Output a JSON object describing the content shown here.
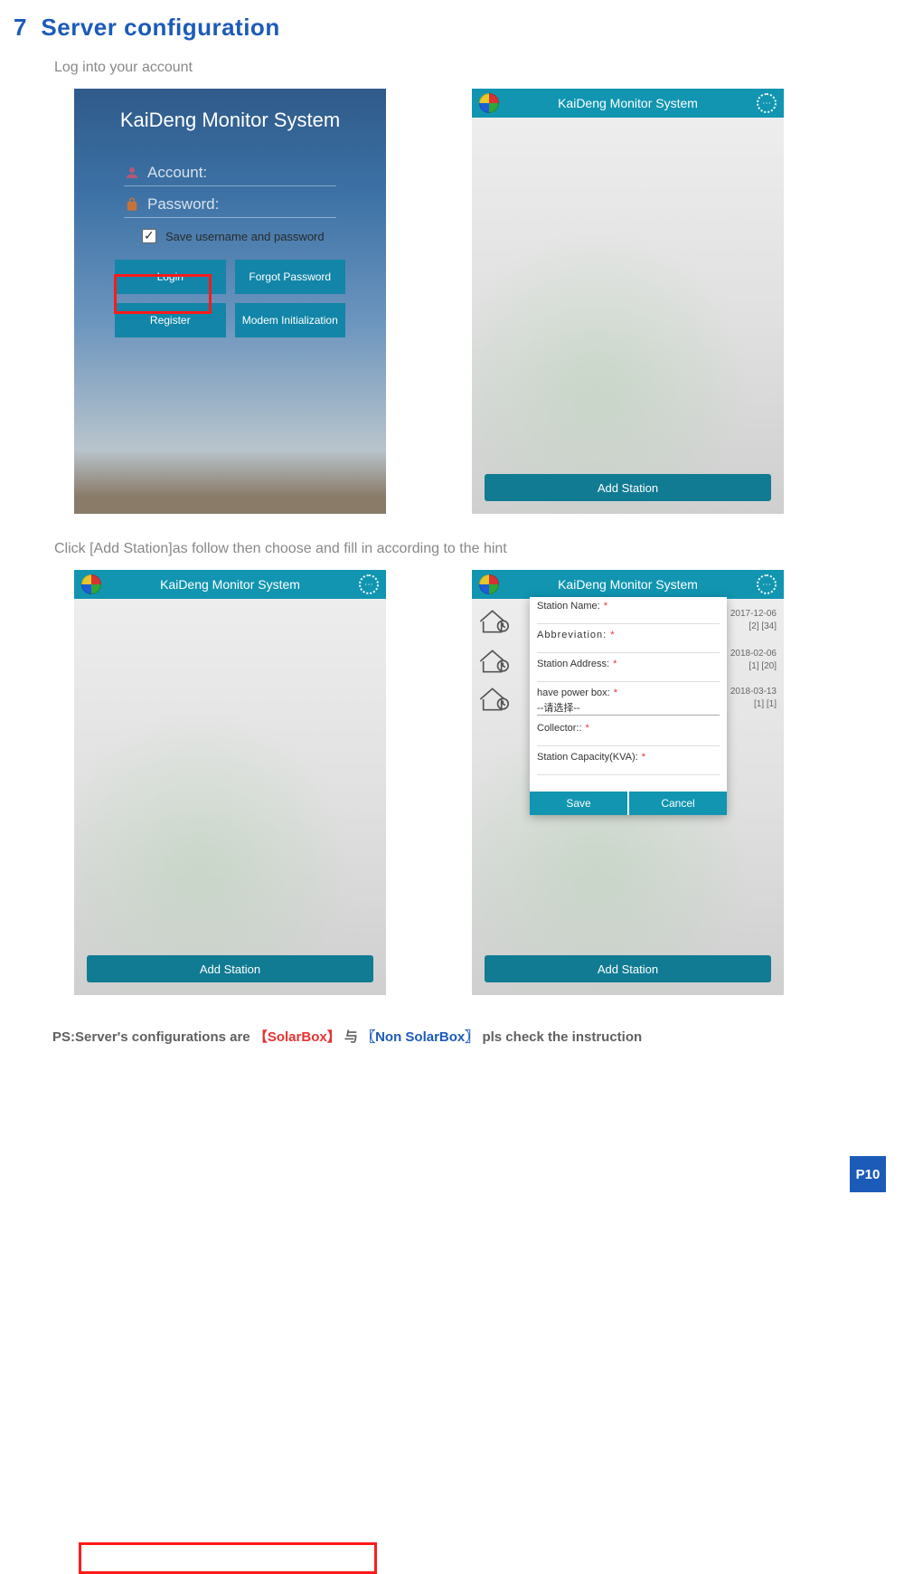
{
  "heading_num": "7",
  "heading_text": "Server configuration",
  "para1": "Log into your account",
  "para2": "Click [Add Station]as follow then choose and fill in according to the hint",
  "login": {
    "title": "KaiDeng Monitor System",
    "account": "Account:",
    "password": "Password:",
    "save": "Save username and password",
    "login": "Login",
    "forgot": "Forgot Password",
    "register": "Register",
    "modem": "Modem Initialization"
  },
  "header_title": "KaiDeng Monitor System",
  "add_station": "Add Station",
  "form": {
    "station_name": "Station Name:",
    "abbrev": "Abbreviation:",
    "station_addr": "Station Address:",
    "power_box": "have power box:",
    "select_opt": "--请选择--",
    "collector": "Collector::",
    "capacity": "Station Capacity(KVA):",
    "save": "Save",
    "cancel": "Cancel"
  },
  "back_dates": {
    "d1": "2017-12-06",
    "d1b": "[2] [34]",
    "d2": "2018-02-06",
    "d2b": "[1] [20]",
    "d3": "2018-03-13",
    "d3b": "[1] [1]"
  },
  "ps": {
    "pre": "PS:Server's configurations are",
    "b1": "【",
    "solarbox": "SolarBox",
    "b2": "】",
    "mid": "与",
    "b3": "〖",
    "nonsolar": "Non SolarBox",
    "b4": "〗",
    "post": "pls check the instruction"
  },
  "page_number": "P10"
}
